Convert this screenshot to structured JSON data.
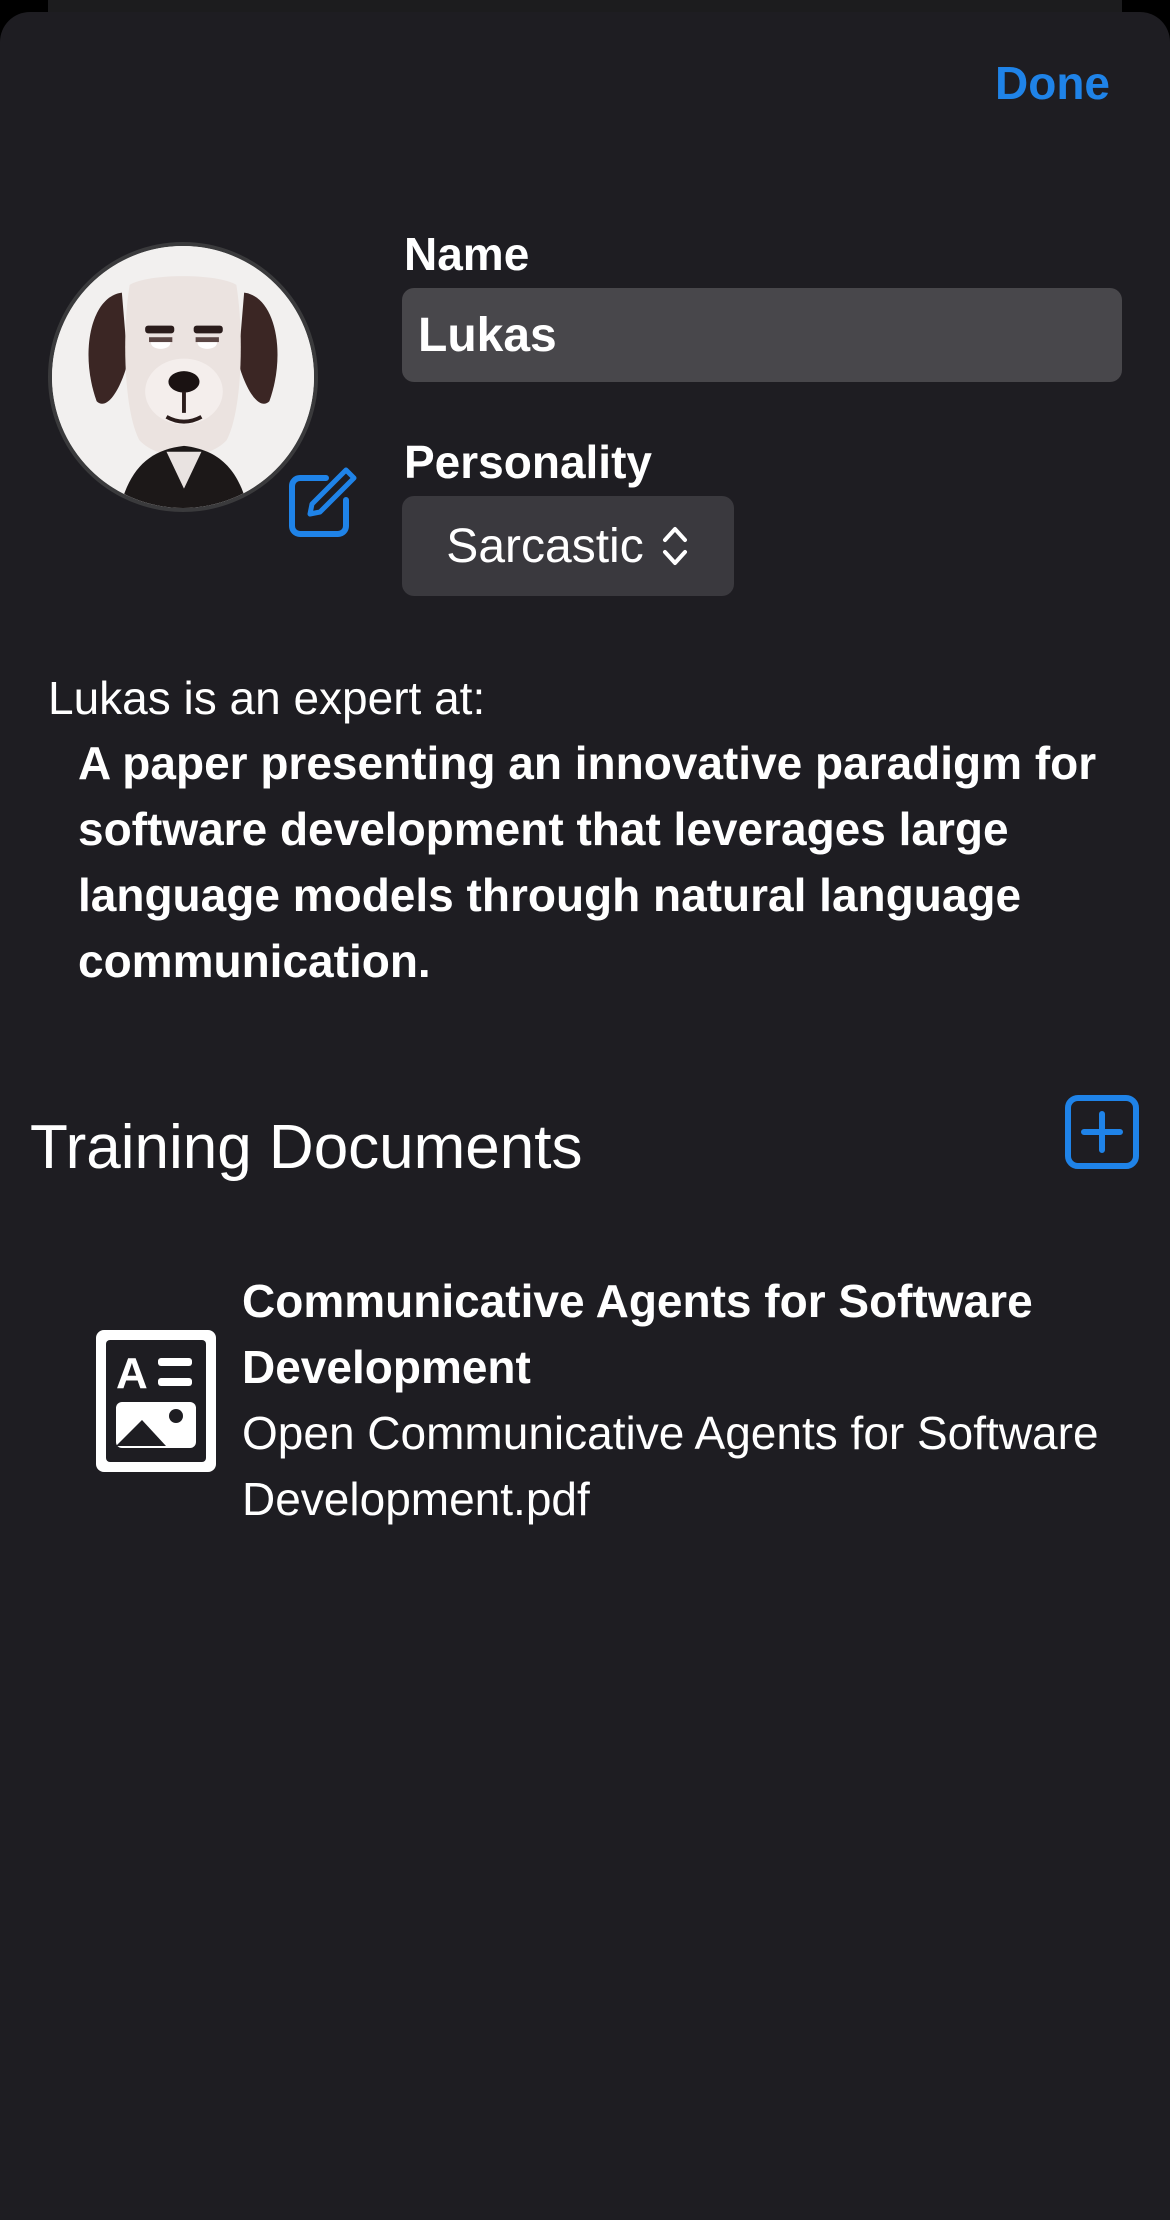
{
  "header": {
    "done_label": "Done"
  },
  "profile": {
    "avatar_icon": "dog-avatar",
    "edit_icon": "square-pencil-icon",
    "name_label": "Name",
    "name_value": "Lukas",
    "personality_label": "Personality",
    "personality_value": "Sarcastic",
    "personality_icon": "chevron-up-down-icon"
  },
  "expertise": {
    "intro": "Lukas is an expert at:",
    "description": "A paper presenting an innovative paradigm for software development that leverages large language models through natural language communication."
  },
  "training": {
    "title": "Training Documents",
    "add_icon": "plus-square-icon",
    "documents": [
      {
        "icon": "document-richtext-icon",
        "title": "Communicative Agents for Software Development",
        "file": "Open Communicative Agents for Software Development.pdf"
      }
    ]
  },
  "colors": {
    "accent": "#1f83e8",
    "background": "#1e1d22",
    "field_background": "#48474b"
  }
}
